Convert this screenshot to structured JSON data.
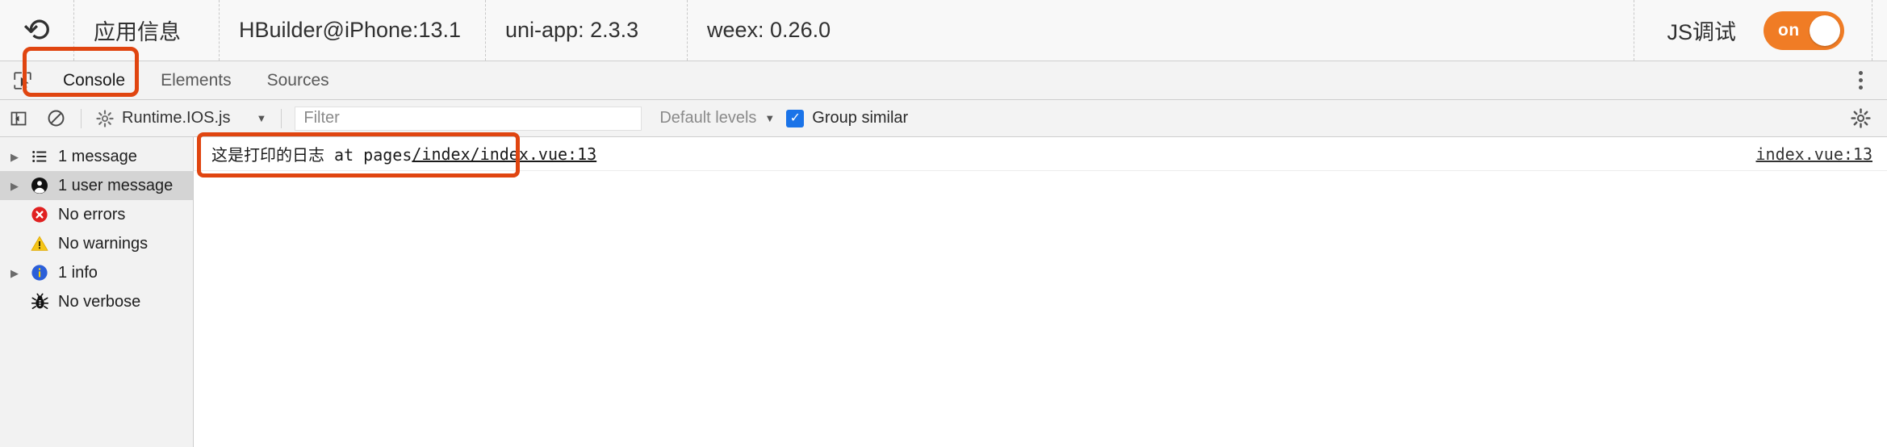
{
  "topbar": {
    "reload_icon": "reload-icon",
    "app_info_label": "应用信息",
    "hbuilder_label": "HBuilder@iPhone:13.1",
    "uniapp_label": "uni-app: 2.3.3",
    "weex_label": "weex: 0.26.0",
    "js_debug_label": "JS调试",
    "toggle_state_label": "on",
    "toggle_color": "#f07c25"
  },
  "devtools": {
    "inspect_icon": "inspect-element-icon",
    "tabs": [
      {
        "label": "Console",
        "active": true
      },
      {
        "label": "Elements",
        "active": false
      },
      {
        "label": "Sources",
        "active": false
      }
    ],
    "more_icon": "more-vertical-icon"
  },
  "filterbar": {
    "sidebar_toggle_icon": "show-console-sidebar-icon",
    "clear_icon": "clear-console-icon",
    "context_icon": "gear-icon",
    "context_value": "Runtime.IOS.js",
    "context_caret": "▼",
    "filter_placeholder": "Filter",
    "filter_value": "",
    "levels_label": "Default levels",
    "levels_caret": "▼",
    "group_similar_label": "Group similar",
    "group_similar_checked": true,
    "group_similar_check_glyph": "✓",
    "checkbox_color": "#1a73e8",
    "settings_icon": "gear-icon"
  },
  "sidebar": {
    "items": [
      {
        "label": "1 message",
        "icon": "list-icon",
        "expandable": true,
        "selected": false
      },
      {
        "label": "1 user message",
        "icon": "user-icon",
        "expandable": true,
        "selected": true
      },
      {
        "label": "No errors",
        "icon": "error-icon",
        "expandable": false,
        "selected": false
      },
      {
        "label": "No warnings",
        "icon": "warning-icon",
        "expandable": false,
        "selected": false
      },
      {
        "label": "1 info",
        "icon": "info-icon",
        "expandable": true,
        "selected": false
      },
      {
        "label": "No verbose",
        "icon": "bug-icon",
        "expandable": false,
        "selected": false
      }
    ],
    "expand_arrow": "▶"
  },
  "console": {
    "log": {
      "message_prefix": "这是打印的日志 at pages",
      "message_link": "/index/index.vue:13",
      "source_link": "index.vue:13"
    }
  },
  "annotations": {
    "color": "#e04510",
    "console_tab_box": "highlight-console-tab",
    "log_message_box": "highlight-log-message"
  }
}
